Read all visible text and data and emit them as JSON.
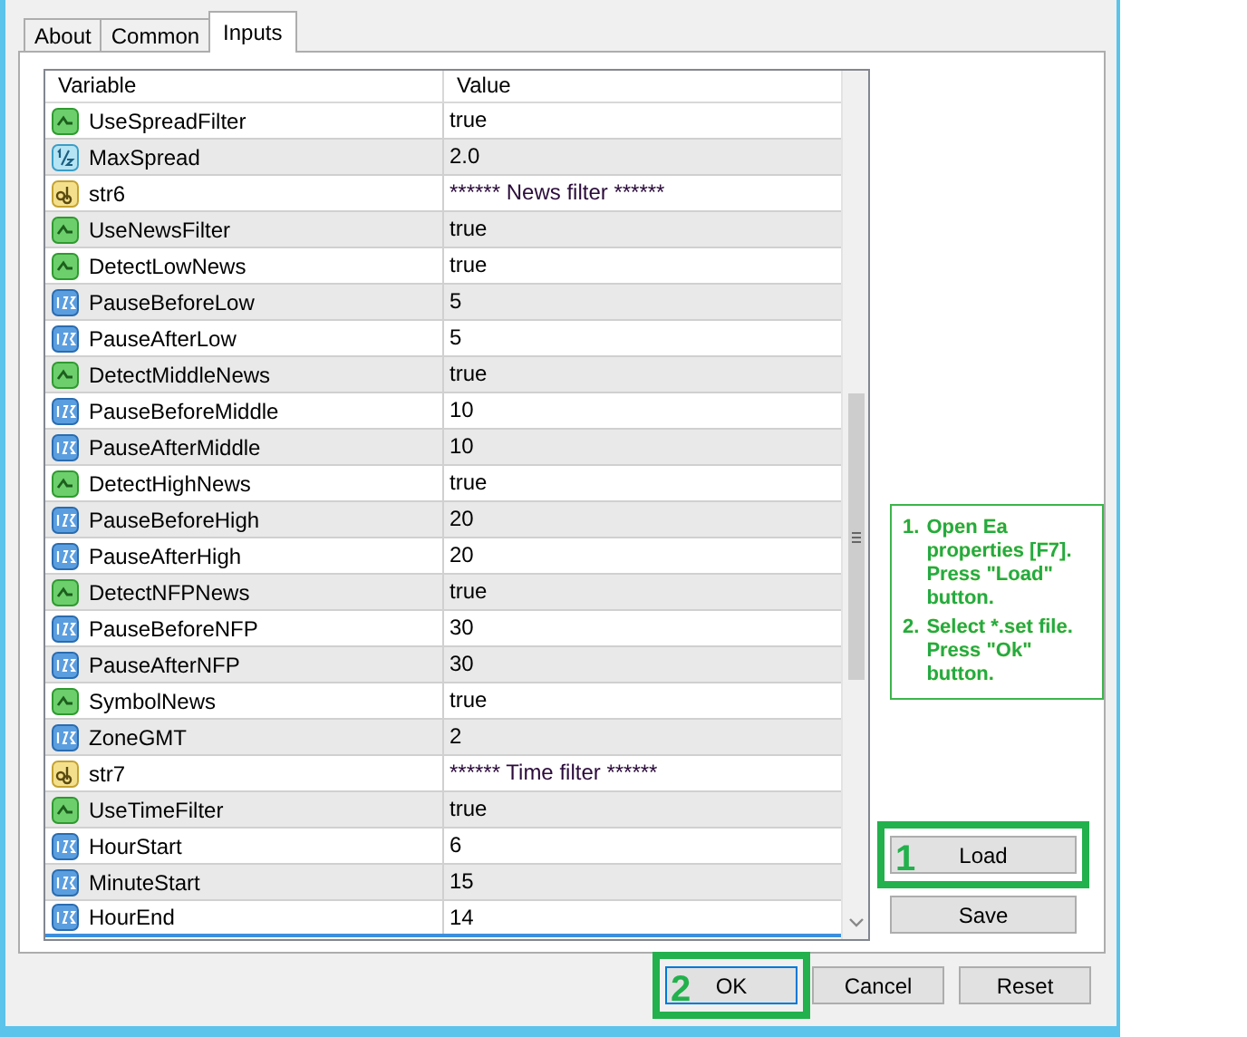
{
  "tabs": [
    {
      "label": "About",
      "selected": false
    },
    {
      "label": "Common",
      "selected": false
    },
    {
      "label": "Inputs",
      "selected": true
    }
  ],
  "table": {
    "columns": [
      "Variable",
      "Value"
    ],
    "rows": [
      {
        "kind": "bool",
        "name": "UseSpreadFilter",
        "value": "true"
      },
      {
        "kind": "double",
        "name": "MaxSpread",
        "value": "2.0"
      },
      {
        "kind": "string",
        "name": "str6",
        "value": "****** News filter ******"
      },
      {
        "kind": "bool",
        "name": "UseNewsFilter",
        "value": "true"
      },
      {
        "kind": "bool",
        "name": "DetectLowNews",
        "value": "true"
      },
      {
        "kind": "int",
        "name": "PauseBeforeLow",
        "value": "5"
      },
      {
        "kind": "int",
        "name": "PauseAfterLow",
        "value": "5"
      },
      {
        "kind": "bool",
        "name": "DetectMiddleNews",
        "value": "true"
      },
      {
        "kind": "int",
        "name": "PauseBeforeMiddle",
        "value": "10"
      },
      {
        "kind": "int",
        "name": "PauseAfterMiddle",
        "value": "10"
      },
      {
        "kind": "bool",
        "name": "DetectHighNews",
        "value": "true"
      },
      {
        "kind": "int",
        "name": "PauseBeforeHigh",
        "value": "20"
      },
      {
        "kind": "int",
        "name": "PauseAfterHigh",
        "value": "20"
      },
      {
        "kind": "bool",
        "name": "DetectNFPNews",
        "value": "true"
      },
      {
        "kind": "int",
        "name": "PauseBeforeNFP",
        "value": "30"
      },
      {
        "kind": "int",
        "name": "PauseAfterNFP",
        "value": "30"
      },
      {
        "kind": "bool",
        "name": "SymbolNews",
        "value": "true"
      },
      {
        "kind": "int",
        "name": "ZoneGMT",
        "value": "2"
      },
      {
        "kind": "string",
        "name": "str7",
        "value": "****** Time filter ******"
      },
      {
        "kind": "bool",
        "name": "UseTimeFilter",
        "value": "true"
      },
      {
        "kind": "int",
        "name": "HourStart",
        "value": "6"
      },
      {
        "kind": "int",
        "name": "MinuteStart",
        "value": "15"
      },
      {
        "kind": "int",
        "name": "HourEnd",
        "value": "14"
      }
    ]
  },
  "note": [
    {
      "number": "1.",
      "lines": [
        "Open Ea properties [F7].",
        "Press \"Load\" button."
      ]
    },
    {
      "number": "2.",
      "lines": [
        "Select  *.set file.",
        "Press \"Ok\" button."
      ]
    }
  ],
  "side_buttons": [
    {
      "label": "Load",
      "highlight": "1"
    },
    {
      "label": "Save"
    }
  ],
  "footer_buttons": [
    {
      "label": "OK",
      "highlight": "2"
    },
    {
      "label": "Cancel"
    },
    {
      "label": "Reset"
    }
  ]
}
